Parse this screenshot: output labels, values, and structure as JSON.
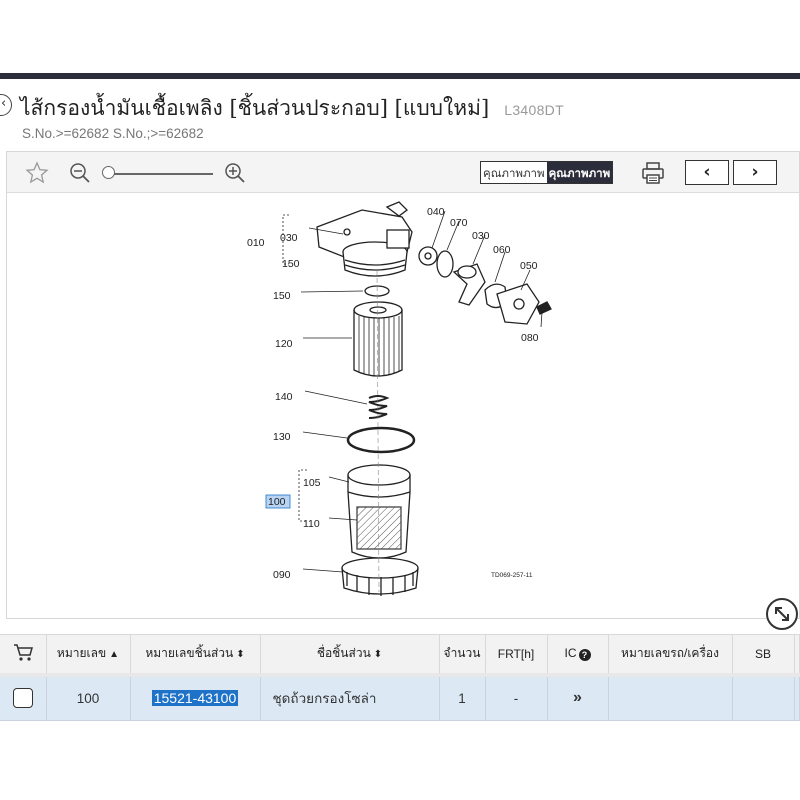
{
  "header": {
    "title": "ไส้กรองน้ำมันเชื้อเพลิง [ชิ้นส่วนประกอบ] [แบบใหม่]",
    "model": "L3408DT",
    "serial": "S.No.>=62682 S.No.;>=62682"
  },
  "toolbar": {
    "quality_off_label": "คุณภาพภาพ",
    "quality_on_label": "คุณภาพภาพ"
  },
  "diagram": {
    "code": "TD069-257-11",
    "callouts": {
      "c010": "010",
      "c030a": "030",
      "c150a": "150",
      "c040": "040",
      "c070": "070",
      "c030b": "030",
      "c060": "060",
      "c050": "050",
      "c080": "080",
      "c150b": "150",
      "c120": "120",
      "c140": "140",
      "c130": "130",
      "c105": "105",
      "c100": "100",
      "c110": "110",
      "c090": "090"
    }
  },
  "table": {
    "headers": {
      "ref_no": "หมายเลข",
      "part_no": "หมายเลขชิ้นส่วน",
      "part_name": "ชื่อชิ้นส่วน",
      "qty": "จำนวน",
      "frt": "FRT[h]",
      "ic": "IC",
      "machine_no": "หมายเลขรถ/เครื่อง",
      "sb": "SB"
    },
    "rows": [
      {
        "ref_no": "100",
        "part_no": "15521-43100",
        "part_name": "ชุดถ้วยกรองโซล่า",
        "qty": "1",
        "frt": "-",
        "ic": "»",
        "machine_no": "",
        "sb": ""
      }
    ]
  }
}
